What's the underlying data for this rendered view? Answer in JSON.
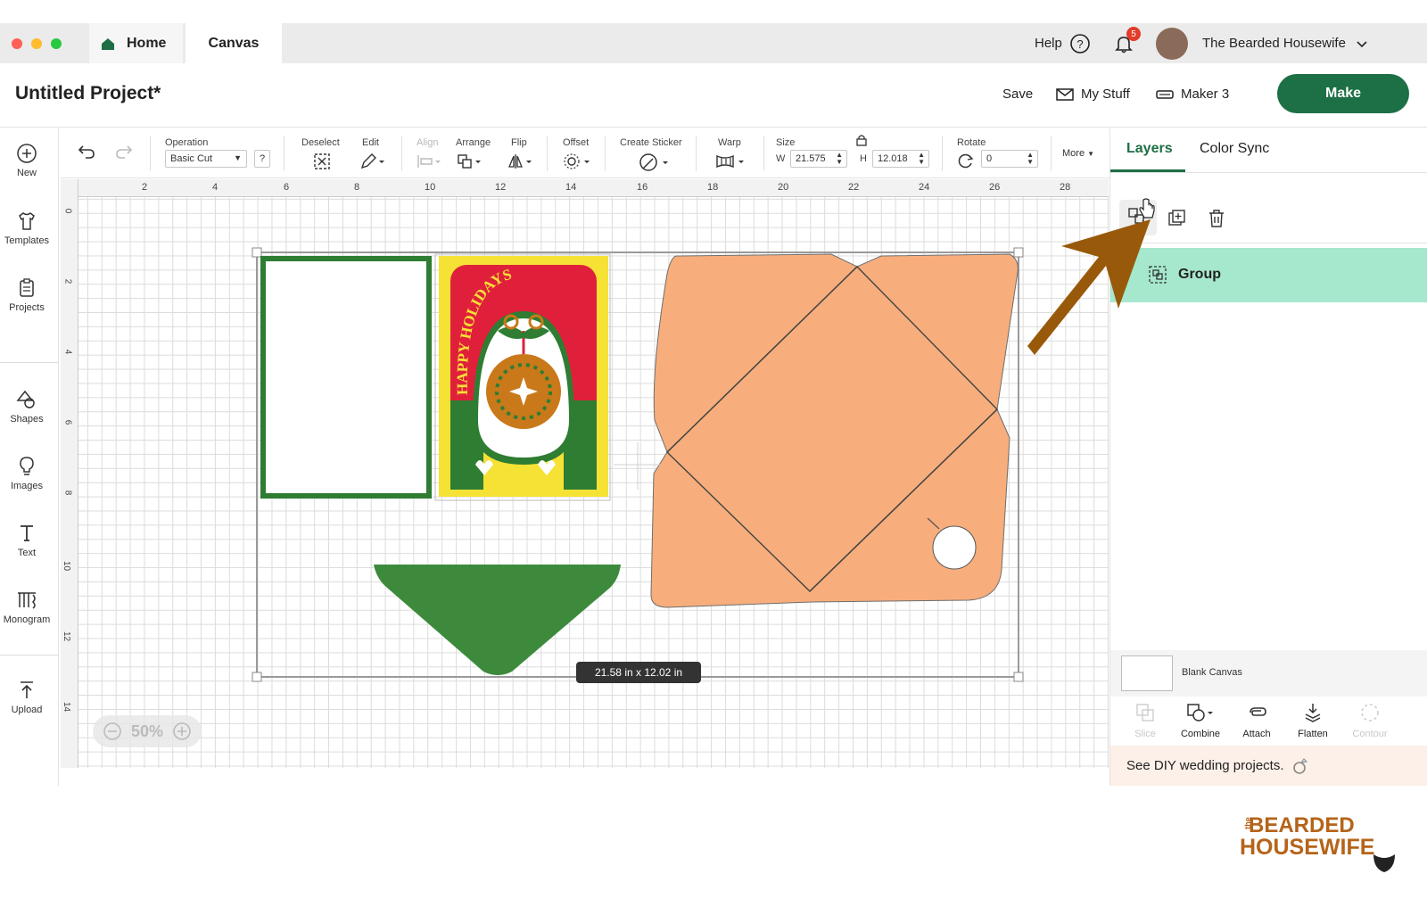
{
  "tabs": {
    "home": "Home",
    "canvas": "Canvas"
  },
  "topbar": {
    "help": "Help",
    "notification_count": "5",
    "user_name": "The Bearded Housewife"
  },
  "header": {
    "project_title": "Untitled Project*",
    "save": "Save",
    "my_stuff": "My Stuff",
    "machine": "Maker 3",
    "make": "Make"
  },
  "sidebar": {
    "items": [
      {
        "label": "New",
        "icon": "plus-circle-icon"
      },
      {
        "label": "Templates",
        "icon": "shirt-icon"
      },
      {
        "label": "Projects",
        "icon": "clipboard-icon"
      },
      {
        "label": "Shapes",
        "icon": "shapes-icon"
      },
      {
        "label": "Images",
        "icon": "lightbulb-icon"
      },
      {
        "label": "Text",
        "icon": "text-icon"
      },
      {
        "label": "Monogram",
        "icon": "monogram-icon"
      },
      {
        "label": "Upload",
        "icon": "upload-icon"
      }
    ]
  },
  "toolbar": {
    "operation_label": "Operation",
    "operation_value": "Basic Cut",
    "help_mark": "?",
    "deselect": "Deselect",
    "edit": "Edit",
    "align": "Align",
    "arrange": "Arrange",
    "flip": "Flip",
    "offset": "Offset",
    "create_sticker": "Create Sticker",
    "warp": "Warp",
    "size": "Size",
    "w_label": "W",
    "w_value": "21.575",
    "h_label": "H",
    "h_value": "12.018",
    "rotate": "Rotate",
    "rotate_value": "0",
    "more": "More"
  },
  "ruler": {
    "top": [
      "2",
      "4",
      "6",
      "8",
      "10",
      "12",
      "14",
      "16",
      "18",
      "20",
      "22",
      "24",
      "26",
      "28"
    ],
    "left": [
      "0",
      "2",
      "4",
      "6",
      "8",
      "10",
      "12",
      "14"
    ]
  },
  "card": {
    "text": "HAPPY HOLIDAYS",
    "colors": {
      "green": "#2e7d32",
      "red": "#e0203b",
      "yellow": "#f6e135",
      "orange": "#c9791a"
    }
  },
  "envelope_color": "#f7ae7c",
  "size_tooltip": "21.58  in x 12.02  in",
  "zoom": "50%",
  "panel": {
    "tab_layers": "Layers",
    "tab_color_sync": "Color Sync",
    "group_label": "Group",
    "blank_canvas": "Blank Canvas",
    "actions": [
      {
        "label": "Slice",
        "enabled": false
      },
      {
        "label": "Combine",
        "enabled": true
      },
      {
        "label": "Attach",
        "enabled": true
      },
      {
        "label": "Flatten",
        "enabled": true
      },
      {
        "label": "Contour",
        "enabled": false
      }
    ],
    "promo": "See DIY wedding projects."
  },
  "brand": {
    "line1": "BEARDED",
    "line2": "HOUSEWIFE",
    "prefix": "the"
  },
  "accent": "#1d6f45",
  "arrow_color": "#985a0a"
}
